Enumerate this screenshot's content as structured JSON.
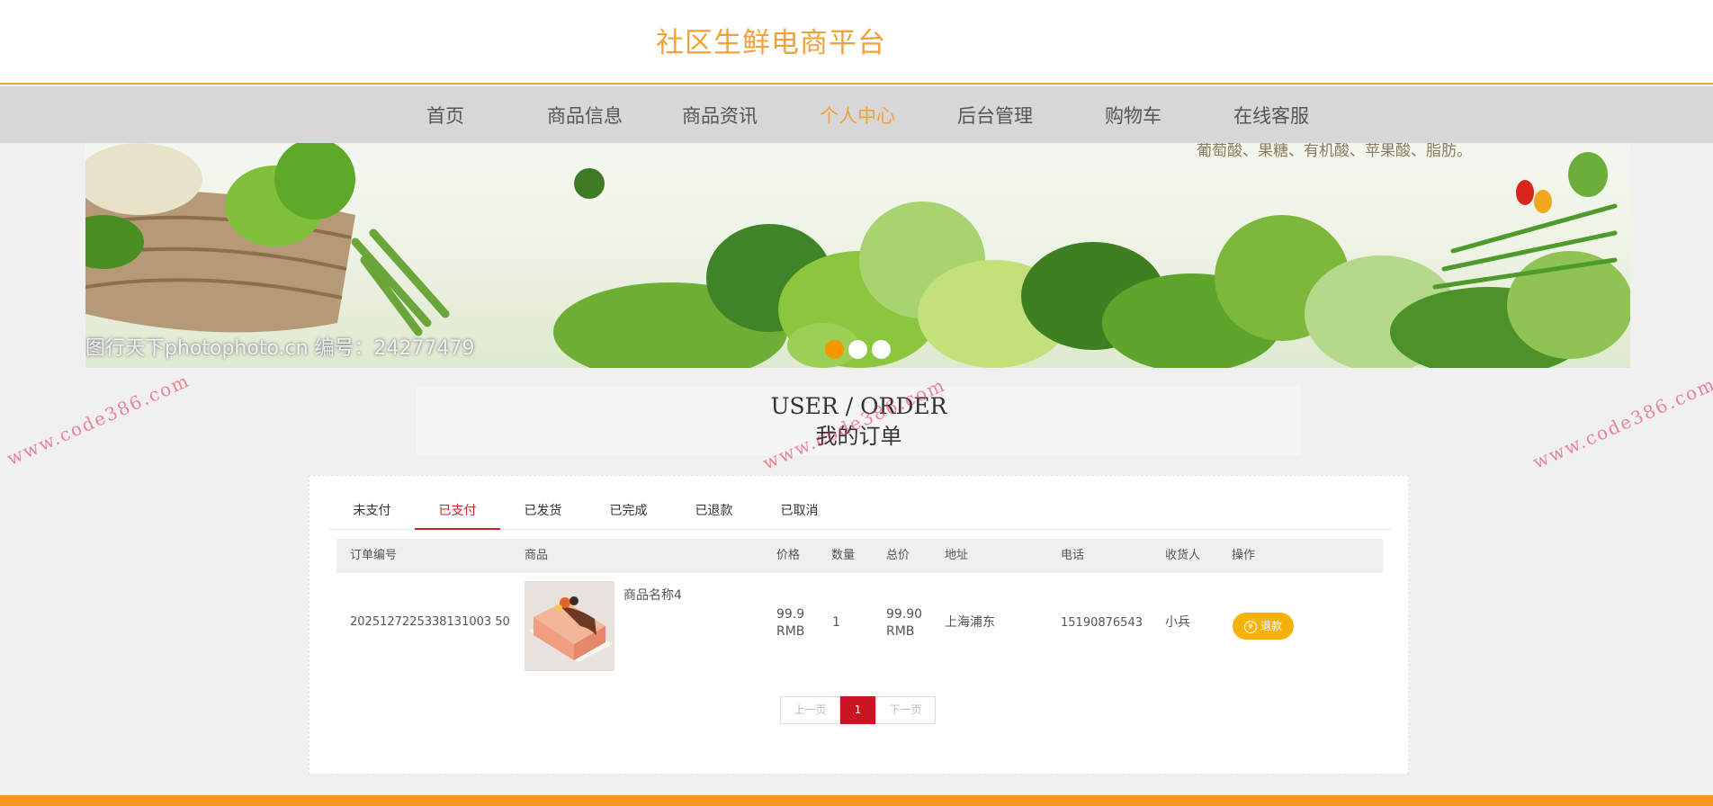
{
  "header": {
    "site_title": "社区生鲜电商平台"
  },
  "nav": {
    "items": [
      {
        "label": "首页",
        "active": false
      },
      {
        "label": "商品信息",
        "active": false
      },
      {
        "label": "商品资讯",
        "active": false
      },
      {
        "label": "个人中心",
        "active": true
      },
      {
        "label": "后台管理",
        "active": false
      },
      {
        "label": "购物车",
        "active": false
      },
      {
        "label": "在线客服",
        "active": false
      }
    ]
  },
  "banner": {
    "watermark_text": "图行天下photophoto.cn  编号：24277479",
    "top_text": "葡萄酸、果糖、有机酸、苹果酸、脂肪。",
    "slides": 3,
    "active_slide": 1
  },
  "section_title": {
    "en": "USER / ORDER",
    "cn": "我的订单"
  },
  "tabs": [
    {
      "label": "未支付",
      "active": false
    },
    {
      "label": "已支付",
      "active": true
    },
    {
      "label": "已发货",
      "active": false
    },
    {
      "label": "已完成",
      "active": false
    },
    {
      "label": "已退款",
      "active": false
    },
    {
      "label": "已取消",
      "active": false
    }
  ],
  "table": {
    "headers": [
      "订单编号",
      "商品",
      "价格",
      "数量",
      "总价",
      "地址",
      "电话",
      "收货人",
      "操作"
    ],
    "rows": [
      {
        "order_no": "2025127225338131003 50",
        "product_name": "商品名称4",
        "price_value": "99.9",
        "price_unit": "RMB",
        "quantity": "1",
        "total_value": "99.90",
        "total_unit": "RMB",
        "address": "上海浦东",
        "phone": "15190876543",
        "receiver": "小兵",
        "action_label": "退款",
        "action_icon": "yen-circle-icon"
      }
    ]
  },
  "pagination": {
    "prev": "上一页",
    "current": "1",
    "next": "下一页"
  },
  "watermark": "www.code386.com",
  "colors": {
    "accent": "#f0a23a",
    "tab_active": "#c6271d",
    "pager_current": "#c81623",
    "refund_button": "#f6b20b",
    "footer": "#f39a1e"
  }
}
